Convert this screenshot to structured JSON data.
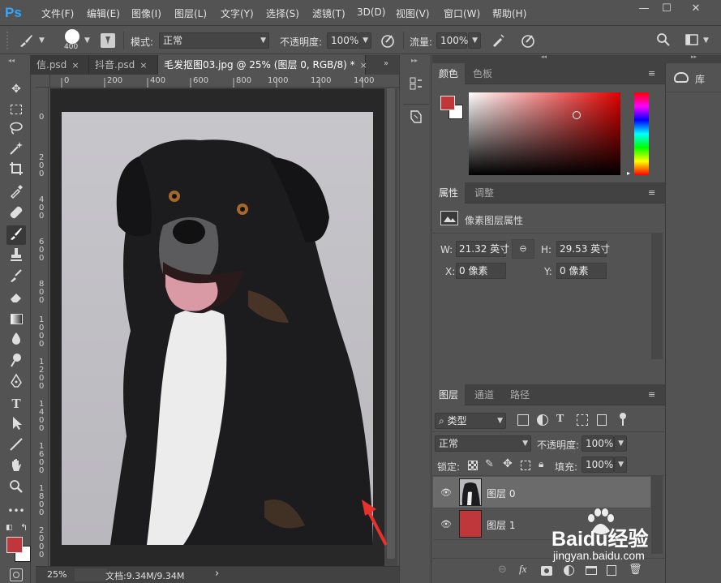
{
  "app": {
    "logo": "Ps",
    "menu": [
      "文件(F)",
      "编辑(E)",
      "图像(I)",
      "图层(L)",
      "文字(Y)",
      "选择(S)",
      "滤镜(T)",
      "3D(D)",
      "视图(V)",
      "窗口(W)",
      "帮助(H)"
    ]
  },
  "options": {
    "brush_size": "400",
    "mode_label": "模式:",
    "mode_value": "正常",
    "opacity_label": "不透明度:",
    "opacity_value": "100%",
    "flow_label": "流量:",
    "flow_value": "100%"
  },
  "tabs": [
    {
      "label": "信.psd",
      "close": "×"
    },
    {
      "label": "抖音.psd",
      "close": "×"
    },
    {
      "label": "毛发抠图03.jpg @ 25% (图层 0, RGB/8) *",
      "close": "×"
    }
  ],
  "ruler": {
    "top_ticks": [
      "0",
      "200",
      "400",
      "600",
      "800",
      "1000",
      "1200",
      "1400"
    ],
    "left_ticks": [
      "0",
      "2\n0\n0",
      "4\n0\n0",
      "6\n0\n0",
      "8\n0\n0",
      "1\n0\n0\n0",
      "1\n2\n0\n0",
      "1\n4\n0\n0",
      "1\n6\n0\n0",
      "1\n8\n0\n0",
      "2\n0\n0\n0"
    ]
  },
  "status": {
    "zoom": "25%",
    "doc": "文档:9.34M/9.34M",
    "arrow": "›"
  },
  "color_panel": {
    "tabs": [
      "颜色",
      "色板"
    ],
    "foreground": "#c0373b",
    "background": "#ffffff"
  },
  "properties_panel": {
    "tabs": [
      "属性",
      "调整"
    ],
    "title": "像素图层属性",
    "w_label": "W:",
    "w_value": "21.32 英寸",
    "h_label": "H:",
    "h_value": "29.53 英寸",
    "x_label": "X:",
    "x_value": "0 像素",
    "y_label": "Y:",
    "y_value": "0 像素"
  },
  "layers_panel": {
    "tabs": [
      "图层",
      "通道",
      "路径"
    ],
    "filter": "类型",
    "blend": "正常",
    "opacity_label": "不透明度:",
    "opacity_value": "100%",
    "lock_label": "锁定:",
    "fill_label": "填充:",
    "fill_value": "100%",
    "layers": [
      {
        "name": "图层 0",
        "selected": true
      },
      {
        "name": "图层 1",
        "selected": false,
        "color": "#c0373b"
      }
    ],
    "fx": "fx"
  },
  "library": {
    "label": "库"
  },
  "watermark": {
    "brand": "Baidu经验",
    "url": "jingyan.baidu.com"
  }
}
